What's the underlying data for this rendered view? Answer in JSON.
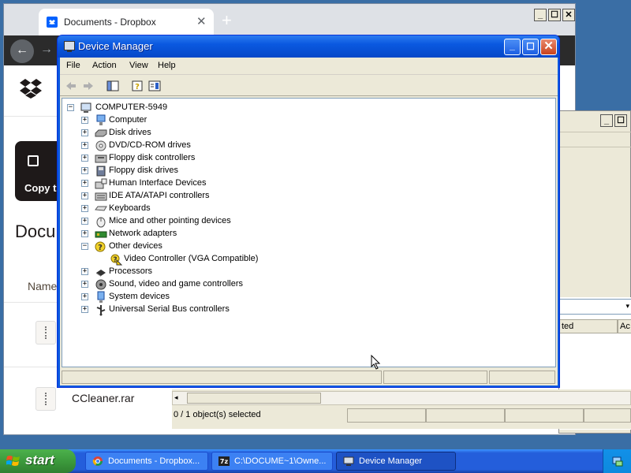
{
  "browser": {
    "tab_title": "Documents - Dropbox",
    "tab_close": "✕",
    "new_tab": "+",
    "btn_min": "_",
    "btn_max": "☐",
    "btn_close": "✕",
    "back": "←",
    "forward": "→",
    "copy_label": "Copy t",
    "heading": "Docu",
    "name_header": "Name",
    "file2_name": "CCleaner.rar"
  },
  "zip": {
    "btn_min": "_",
    "btn_max": "☐",
    "col1": "ted",
    "col2": "Ac",
    "status": "0 / 1 object(s) selected",
    "scroll_left": "◂",
    "combo_arrow": "▾"
  },
  "dm": {
    "title": "Device Manager",
    "btn_min": "_",
    "btn_max": "☐",
    "btn_close": "✕",
    "menu": [
      "File",
      "Action",
      "View",
      "Help"
    ],
    "tree": {
      "root": "COMPUTER-5949",
      "items": [
        {
          "label": "Computer",
          "expander": "+",
          "icon": "computer-icon"
        },
        {
          "label": "Disk drives",
          "expander": "+",
          "icon": "disk-drive-icon"
        },
        {
          "label": "DVD/CD-ROM drives",
          "expander": "+",
          "icon": "dvd-drive-icon"
        },
        {
          "label": "Floppy disk controllers",
          "expander": "+",
          "icon": "floppy-controller-icon"
        },
        {
          "label": "Floppy disk drives",
          "expander": "+",
          "icon": "floppy-drive-icon"
        },
        {
          "label": "Human Interface Devices",
          "expander": "+",
          "icon": "hid-icon"
        },
        {
          "label": "IDE ATA/ATAPI controllers",
          "expander": "+",
          "icon": "ide-controller-icon"
        },
        {
          "label": "Keyboards",
          "expander": "+",
          "icon": "keyboard-icon"
        },
        {
          "label": "Mice and other pointing devices",
          "expander": "+",
          "icon": "mouse-icon"
        },
        {
          "label": "Network adapters",
          "expander": "+",
          "icon": "network-adapter-icon"
        },
        {
          "label": "Other devices",
          "expander": "−",
          "icon": "unknown-device-icon"
        },
        {
          "label": "Processors",
          "expander": "+",
          "icon": "processor-icon"
        },
        {
          "label": "Sound, video and game controllers",
          "expander": "+",
          "icon": "sound-icon"
        },
        {
          "label": "System devices",
          "expander": "+",
          "icon": "system-device-icon"
        },
        {
          "label": "Universal Serial Bus controllers",
          "expander": "+",
          "icon": "usb-icon"
        }
      ],
      "child": "Video Controller (VGA Compatible)"
    }
  },
  "taskbar": {
    "start": "start",
    "tasks": [
      {
        "label": "Documents - Dropbox..."
      },
      {
        "label": "C:\\DOCUME~1\\Owne..."
      },
      {
        "label": "Device Manager"
      }
    ]
  },
  "colors": {
    "xp_title_blue": "#0a58e0",
    "xp_face": "#ece9d8",
    "start_green": "#3c9a3c",
    "dropbox_blue": "#0061fe"
  }
}
